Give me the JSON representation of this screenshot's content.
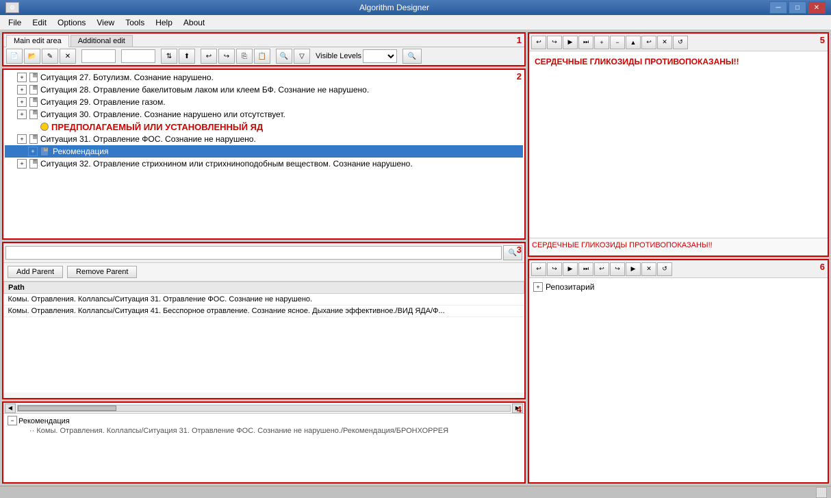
{
  "titleBar": {
    "title": "Algorithm Designer",
    "minimizeBtn": "─",
    "maximizeBtn": "□",
    "closeBtn": "✕"
  },
  "menuBar": {
    "items": [
      "File",
      "Edit",
      "Options",
      "View",
      "Tools",
      "Help",
      "About"
    ]
  },
  "toolbar": {
    "tabs": [
      "Main edit area",
      "Additional edit"
    ],
    "visibleLevels": "Visible Levels",
    "panelNumber": "1"
  },
  "panel2": {
    "number": "2",
    "treeItems": [
      {
        "indent": 1,
        "expanded": true,
        "icon": "doc",
        "label": "Ситуация 27. Ботулизм. Сознание нарушено.",
        "level": 1
      },
      {
        "indent": 1,
        "expanded": true,
        "icon": "doc",
        "label": "Ситуация 28. Отравление бакелитовым лаком или клеем БФ. Сознание не нарушено.",
        "level": 1
      },
      {
        "indent": 1,
        "expanded": false,
        "icon": "doc",
        "label": "Ситуация 29. Отравление газом.",
        "level": 1
      },
      {
        "indent": 1,
        "expanded": true,
        "icon": "doc",
        "label": "Ситуация 30. Отравление. Сознание нарушено или отсутствует.",
        "level": 1
      },
      {
        "indent": 2,
        "expanded": false,
        "icon": "circle",
        "label": "ПРЕДПОЛАГАЕМЫЙ ИЛИ УСТАНОВЛЕННЫЙ ЯД",
        "level": 2
      },
      {
        "indent": 1,
        "expanded": true,
        "icon": "doc",
        "label": "Ситуация 31. Отравление ФОС. Сознание не нарушено.",
        "level": 1
      },
      {
        "indent": 2,
        "expanded": true,
        "icon": "doc",
        "label": "Рекомендация",
        "selected": true,
        "level": 2
      },
      {
        "indent": 1,
        "expanded": false,
        "icon": "doc",
        "label": "Ситуация 32. Отравление стрихнином или стрихниноподобным веществом. Сознание нарушено.",
        "level": 1
      }
    ]
  },
  "panel3": {
    "number": "3",
    "searchPlaceholder": "",
    "addParentLabel": "Add Parent",
    "removeParentLabel": "Remove Parent",
    "tableHeader": "Path",
    "tableRows": [
      "Комы. Отравления. Коллапсы/Ситуация 31. Отравление ФОС. Сознание не нарушено.",
      "Комы. Отравления. Коллапсы/Ситуация 41. Бесспорное отравление. Сознание ясное. Дыхание эффективное./ВИД ЯДА/Ф..."
    ]
  },
  "panel4": {
    "number": "4",
    "rootLabel": "Рекомендация",
    "expandState": "−",
    "subPath": "·· Комы. Отравления. Коллапсы/Ситуация 31. Отравление ФОС. Сознание не нарушено./Рекомендация/БРОНХОРРЕЯ"
  },
  "panel5": {
    "number": "5",
    "contentText": "СЕРДЕЧНЫЕ ГЛИКОЗИДЫ ПРОТИВОПОКАЗАНЫ!!",
    "previewText": "СЕРДЕЧНЫЕ ГЛИКОЗИДЫ ПРОТИВОПОКАЗАНЫ!!",
    "toolbarBtns": [
      "↩",
      "↪",
      "▶",
      "⏭",
      "+",
      "−",
      "▲",
      "↩",
      "✕",
      "↺"
    ]
  },
  "panel6": {
    "number": "6",
    "rootLabel": "Репозитарий",
    "expandState": "+",
    "toolbarBtns": [
      "↩",
      "↪",
      "▶",
      "⏭",
      "↩",
      "↪",
      "▶",
      "✕",
      "↺"
    ]
  },
  "statusBar": {
    "text": ""
  }
}
